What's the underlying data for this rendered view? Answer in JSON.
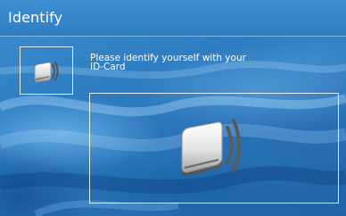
{
  "window": {
    "title": "Identify"
  },
  "prompt": {
    "text": "Please identify yourself with your ID-Card"
  },
  "icons": {
    "small": "id-card-contactless-icon",
    "large": "id-card-contactless-icon"
  },
  "colors": {
    "title_bar": "#3a88cc",
    "background": "#2f7dc2",
    "text": "#ffffff",
    "frame": "#ffffff",
    "wave": "#555555"
  }
}
